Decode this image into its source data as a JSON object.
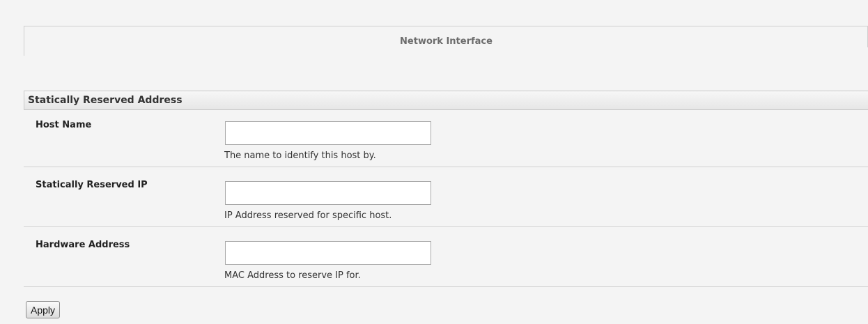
{
  "tab": {
    "title": "Network Interface"
  },
  "section": {
    "title": "Statically Reserved Address"
  },
  "fields": [
    {
      "label": "Host Name",
      "value": "",
      "help": "The name to identify this host by."
    },
    {
      "label": "Statically Reserved IP",
      "value": "",
      "help": "IP Address reserved for specific host."
    },
    {
      "label": "Hardware Address",
      "value": "",
      "help": "MAC Address to reserve IP for."
    }
  ],
  "actions": {
    "apply_label": "Apply"
  }
}
